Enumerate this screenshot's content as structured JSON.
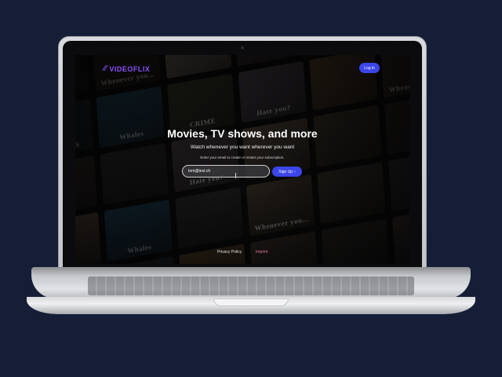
{
  "app": {
    "logo_text": "VIDEOFLIX",
    "login_label": "Log in"
  },
  "hero": {
    "title": "Movies, TV shows, and more",
    "subtitle": "Watch whenever you want wherever you want",
    "hint": "Enter your email to create or restart your subscription.",
    "email_value": "tom@test.ch",
    "signup_label": "Sign Up",
    "signup_icon": "chevron-right-icon"
  },
  "footer": {
    "privacy_label": "Privacy Policy",
    "imprint_label": "Imprint"
  },
  "posters": [
    {
      "title": "",
      "color": "#3a2f2a"
    },
    {
      "title": "Whenever you...",
      "color": "#4a4033"
    },
    {
      "title": "",
      "color": "#c9b6a6"
    },
    {
      "title": "",
      "color": "#5c4a56"
    },
    {
      "title": "",
      "color": "#6d5a3c"
    },
    {
      "title": "",
      "color": "#3b3540"
    },
    {
      "title": "SHADOWS",
      "color": "#2f3a44"
    },
    {
      "title": "Whales",
      "color": "#2f5f7c"
    },
    {
      "title": "CRIME",
      "color": "#4a4a3a"
    },
    {
      "title": "Hate you?",
      "color": "#6a5d68"
    },
    {
      "title": "",
      "color": "#7a5a3a"
    },
    {
      "title": "Whenever you...",
      "color": "#5b5040"
    },
    {
      "title": "",
      "color": "#4c3d3a"
    },
    {
      "title": "",
      "color": "#3d3a3c"
    },
    {
      "title": "Hate you?",
      "color": "#5c5058"
    },
    {
      "title": "",
      "color": "#6a5a4a"
    },
    {
      "title": "",
      "color": "#4e4436"
    },
    {
      "title": "",
      "color": "#3a3430"
    },
    {
      "title": "",
      "color": "#8a7262"
    },
    {
      "title": "Whales",
      "color": "#2c5a78"
    },
    {
      "title": "",
      "color": "#3a3a3a"
    },
    {
      "title": "Whenever you...",
      "color": "#5a4c3c"
    },
    {
      "title": "",
      "color": "#4a4236"
    },
    {
      "title": "",
      "color": "#3e3a38"
    },
    {
      "title": "",
      "color": "#5a4a3a"
    },
    {
      "title": "SHADOWS",
      "color": "#2e3842"
    },
    {
      "title": "",
      "color": "#6a5232"
    },
    {
      "title": "",
      "color": "#4a3e36"
    },
    {
      "title": "",
      "color": "#3a3632"
    },
    {
      "title": "",
      "color": "#4a4440"
    },
    {
      "title": "",
      "color": "#3a3a3e"
    },
    {
      "title": "",
      "color": "#5a4e44"
    },
    {
      "title": "",
      "color": "#42383a"
    },
    {
      "title": "",
      "color": "#3a3a36"
    },
    {
      "title": "",
      "color": "#4e463c"
    },
    {
      "title": "",
      "color": "#3c3834"
    }
  ],
  "colors": {
    "accent": "#3b45e8",
    "logo": "#8a4fff",
    "imprint": "#e07a9b"
  }
}
